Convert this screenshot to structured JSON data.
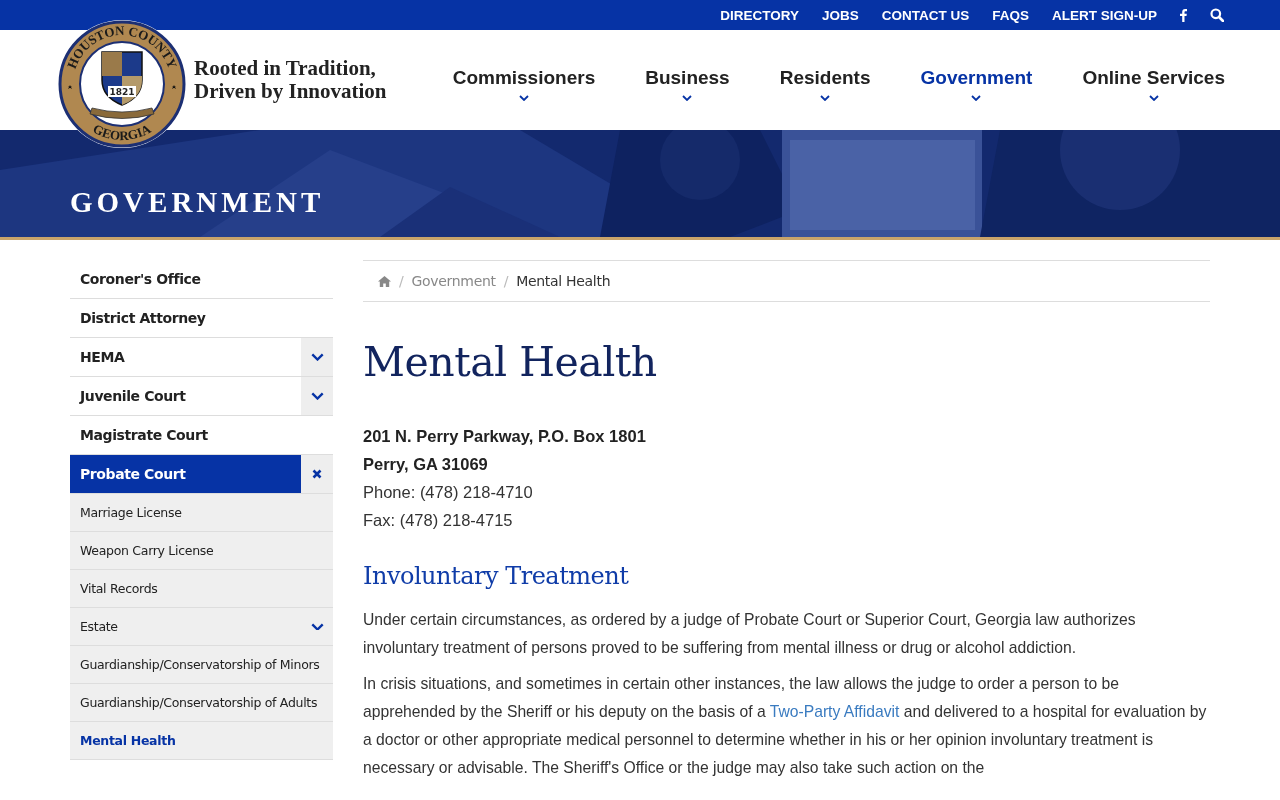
{
  "top_links": [
    {
      "label": "DIRECTORY"
    },
    {
      "label": "JOBS"
    },
    {
      "label": "CONTACT US"
    },
    {
      "label": "FAQS"
    },
    {
      "label": "ALERT SIGN-UP"
    }
  ],
  "logo": {
    "seal_top": "HOUSTON COUNTY",
    "seal_bottom": "GEORGIA",
    "seal_year": "1821",
    "tagline": "Rooted in Tradition,\nDriven by Innovation"
  },
  "main_nav": [
    {
      "label": "Commissioners",
      "selected": false
    },
    {
      "label": "Business",
      "selected": false
    },
    {
      "label": "Residents",
      "selected": false
    },
    {
      "label": "Government",
      "selected": true
    },
    {
      "label": "Online Services",
      "selected": false
    }
  ],
  "hero": {
    "title": "GOVERNMENT"
  },
  "sidebar": {
    "items": [
      {
        "label": "Coroner's Office",
        "kind": "link",
        "selected": false
      },
      {
        "label": "District Attorney",
        "kind": "link",
        "selected": false
      },
      {
        "label": "HEMA",
        "kind": "toggle",
        "expanded": false,
        "selected": false
      },
      {
        "label": "Juvenile Court",
        "kind": "toggle",
        "expanded": false,
        "selected": false
      },
      {
        "label": "Magistrate Court",
        "kind": "link",
        "selected": false
      },
      {
        "label": "Probate Court",
        "kind": "toggle",
        "expanded": true,
        "selected": true,
        "children": [
          {
            "label": "Marriage License",
            "kind": "link",
            "selected": false
          },
          {
            "label": "Weapon Carry License",
            "kind": "link",
            "selected": false
          },
          {
            "label": "Vital Records",
            "kind": "link",
            "selected": false
          },
          {
            "label": "Estate",
            "kind": "toggle",
            "expanded": false,
            "selected": false
          },
          {
            "label": "Guardianship/Conservatorship of Minors",
            "kind": "link",
            "selected": false
          },
          {
            "label": "Guardianship/Conservatorship of Adults",
            "kind": "link",
            "selected": false
          },
          {
            "label": "Mental Health",
            "kind": "link",
            "selected": true
          }
        ]
      }
    ]
  },
  "breadcrumb": {
    "separator": "/",
    "items": [
      {
        "label": "Government",
        "selected": false
      },
      {
        "label": "Mental Health",
        "selected": true
      }
    ]
  },
  "content": {
    "title": "Mental Health",
    "address": [
      "201 N. Perry Parkway, P.O. Box 1801",
      "Perry, GA 31069"
    ],
    "contacts": [
      "Phone: (478) 218-4710",
      "Fax: (478) 218-4715"
    ],
    "section_title": "Involuntary Treatment",
    "paragraphs": [
      [
        {
          "kind": "text",
          "text": "Under certain circumstances, as ordered by a judge of Probate Court or Superior Court, Georgia law authorizes involuntary treatment of persons proved to be suffering from mental illness or drug or alcohol addiction."
        }
      ],
      [
        {
          "kind": "text",
          "text": "In crisis situations, and sometimes in certain other instances, the law allows the judge to order a person to be apprehended by the Sheriff or his deputy on the basis of a "
        },
        {
          "kind": "link",
          "text": "Two-Party Affidavit"
        },
        {
          "kind": "text",
          "text": " and delivered to a hospital for evaluation by a doctor or other appropriate medical personnel to determine whether in his or her opinion involuntary treatment is necessary or advisable. The Sheriff's Office or the judge may also take such action on the"
        }
      ]
    ]
  }
}
